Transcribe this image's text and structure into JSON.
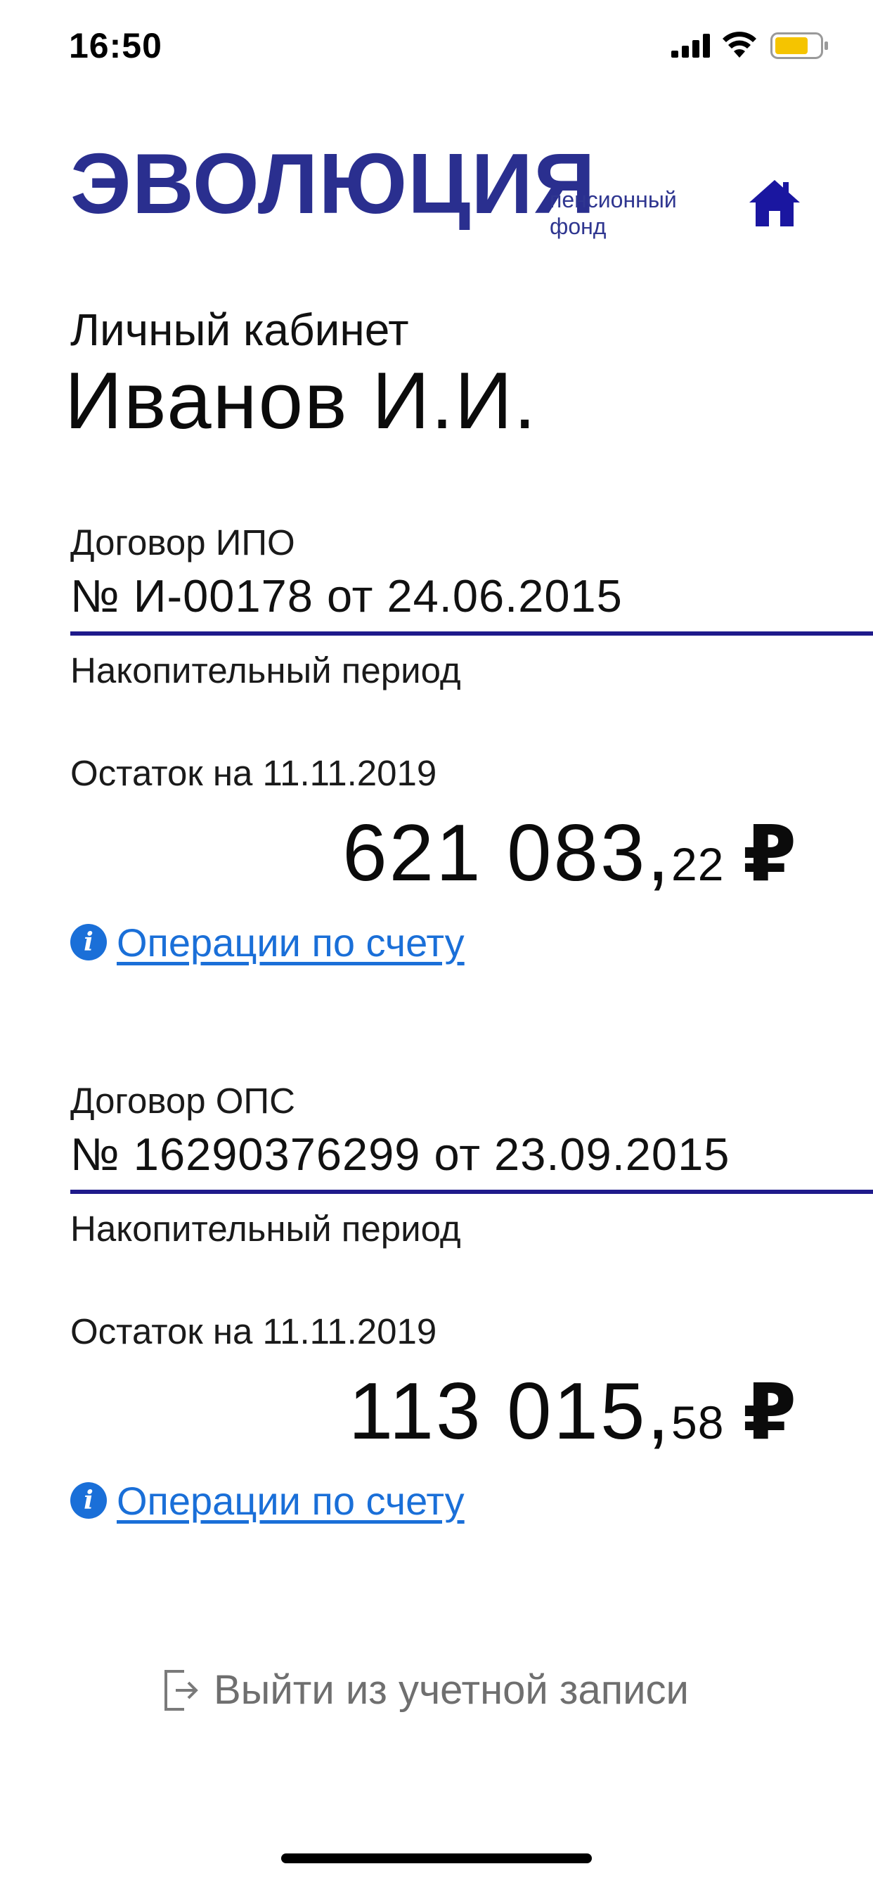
{
  "status_bar": {
    "time": "16:50"
  },
  "header": {
    "logo_text": "ЭВОЛЮЦИЯ",
    "tagline_line1": "пенсионный",
    "tagline_line2": "фонд",
    "brand_color": "#2a2f8f"
  },
  "profile": {
    "section_label": "Личный кабинет",
    "user_name": "Иванов И.И."
  },
  "contracts": [
    {
      "title": "Договор ИПО",
      "number": "№ И-00178 от 24.06.2015",
      "period": "Накопительный период",
      "balance_label": "Остаток на 11.11.2019",
      "balance_main": "621 083,",
      "balance_kop": "22",
      "currency": "₽",
      "ops_link": "Операции по счету"
    },
    {
      "title": "Договор ОПС",
      "number": "№ 16290376299 от 23.09.2015",
      "period": "Накопительный период",
      "balance_label": "Остаток на 11.11.2019",
      "balance_main": "113 015,",
      "balance_kop": "58",
      "currency": "₽",
      "ops_link": "Операции по счету"
    }
  ],
  "logout": {
    "label": "Выйти из учетной записи"
  },
  "colors": {
    "accent_line": "#1f1a8b",
    "link": "#1a6fd8"
  }
}
